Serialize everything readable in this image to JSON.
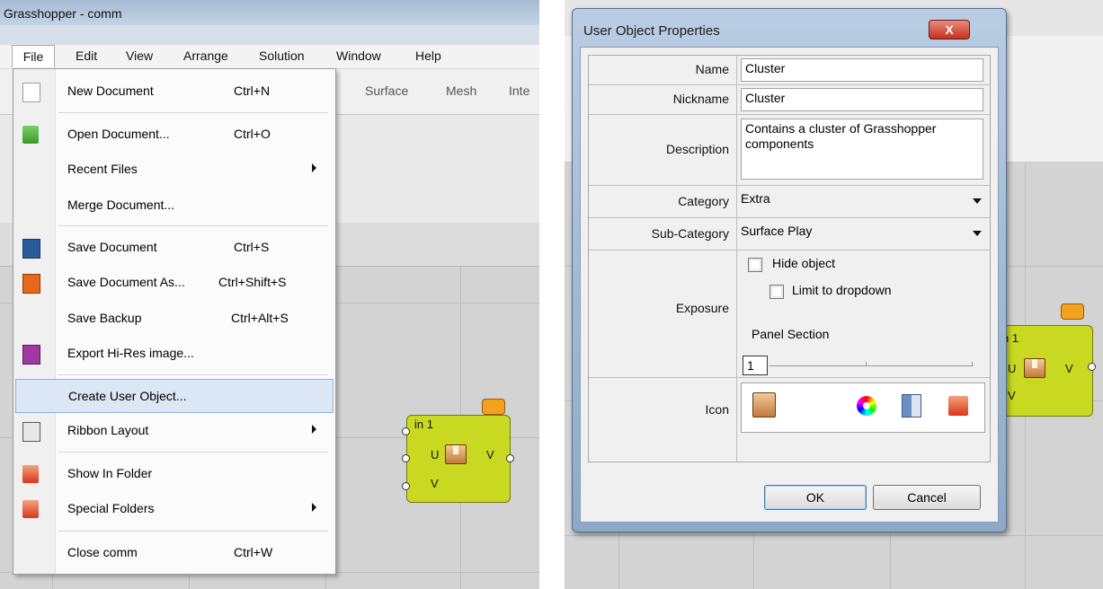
{
  "left": {
    "window_title": "Grasshopper - comm",
    "menubar": [
      "File",
      "Edit",
      "View",
      "Arrange",
      "Solution",
      "Window",
      "Help"
    ],
    "ribbon_tabs": [
      "Surface",
      "Mesh",
      "Inte"
    ],
    "file_menu": [
      {
        "label": "New Document",
        "shortcut": "Ctrl+N",
        "icon": "new-document-icon"
      },
      {
        "label": "Open Document...",
        "shortcut": "Ctrl+O",
        "icon": "open-folder-icon"
      },
      {
        "label": "Recent Files",
        "shortcut": "",
        "icon": "",
        "submenu": true
      },
      {
        "label": "Merge Document...",
        "shortcut": "",
        "icon": ""
      },
      {
        "label": "Save Document",
        "shortcut": "Ctrl+S",
        "icon": "save-disk-icon"
      },
      {
        "label": "Save Document As...",
        "shortcut": "Ctrl+Shift+S",
        "icon": "save-as-disk-icon"
      },
      {
        "label": "Save Backup",
        "shortcut": "Ctrl+Alt+S",
        "icon": ""
      },
      {
        "label": "Export Hi-Res image...",
        "shortcut": "",
        "icon": "export-image-icon"
      },
      {
        "label": "Create User Object...",
        "shortcut": "",
        "icon": "",
        "highlighted": true
      },
      {
        "label": "Ribbon Layout",
        "shortcut": "",
        "icon": "ribbon-layout-icon",
        "submenu": true
      },
      {
        "label": "Show In Folder",
        "shortcut": "",
        "icon": "folder-icon"
      },
      {
        "label": "Special Folders",
        "shortcut": "",
        "icon": "special-folder-icon",
        "submenu": true
      },
      {
        "label": "Close comm",
        "shortcut": "Ctrl+W",
        "icon": ""
      }
    ],
    "component": {
      "title": "in 1",
      "input_u": "U",
      "input_v": "V",
      "output": "V"
    }
  },
  "dialog": {
    "title": "User Object Properties",
    "close_label": "X",
    "name_label": "Name",
    "name_value": "Cluster",
    "nickname_label": "Nickname",
    "nickname_value": "Cluster",
    "description_label": "Description",
    "description_value": "Contains a cluster of Grasshopper components",
    "category_label": "Category",
    "category_value": "Extra",
    "subcategory_label": "Sub-Category",
    "subcategory_value": "Surface Play",
    "exposure_label": "Exposure",
    "hide_object_label": "Hide object",
    "limit_dropdown_label": "Limit to dropdown",
    "panel_section_label": "Panel Section",
    "panel_section_value": "1",
    "icon_label": "Icon",
    "ok_label": "OK",
    "cancel_label": "Cancel"
  },
  "right_component": {
    "title": "n 1",
    "input_u": "U",
    "input_v": "V",
    "output": "V"
  }
}
